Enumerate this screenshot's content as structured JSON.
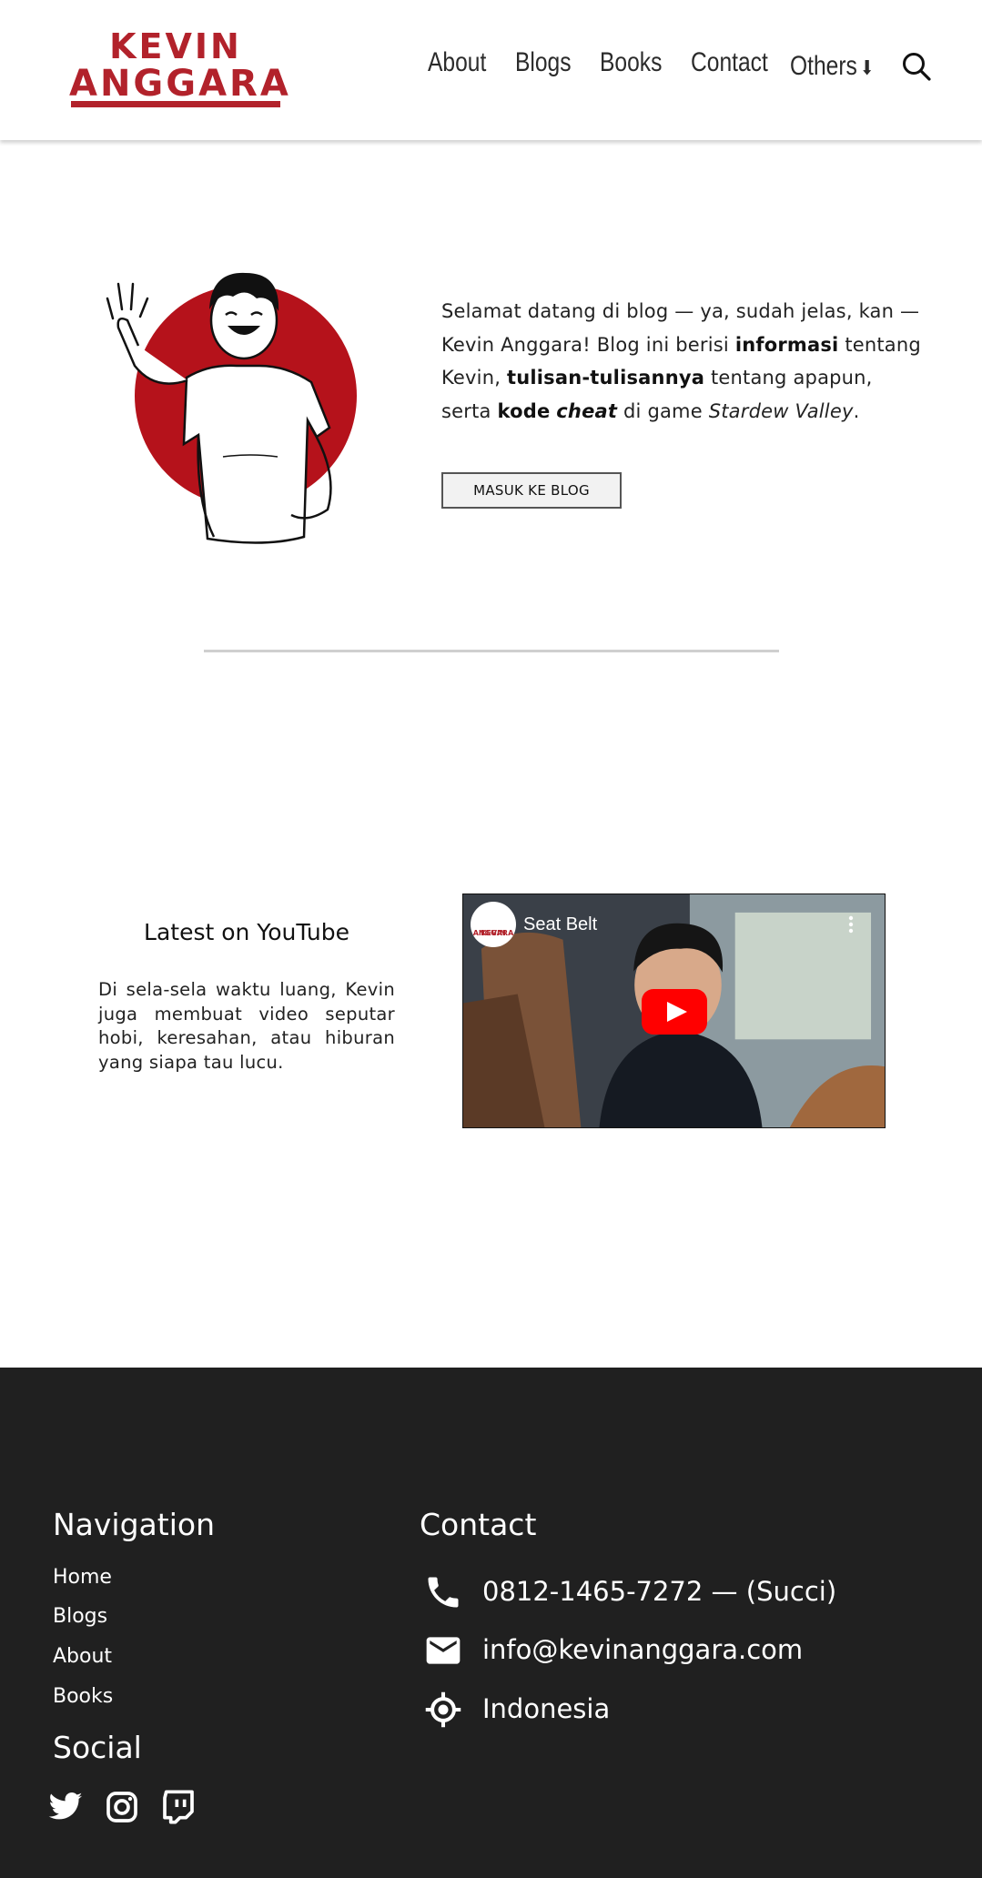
{
  "header": {
    "logo_line1": "KEVIN",
    "logo_line2": "ANGGARA",
    "nav": [
      "About",
      "Blogs",
      "Books",
      "Contact",
      "Others"
    ],
    "others_arrow": "⬇",
    "search_icon": "search-icon",
    "brand_color": "#b2222b"
  },
  "hero": {
    "illustration": "waving-man-illustration",
    "text_1": "Selamat datang di blog — ya, sudah jelas, kan — Kevin Anggara! Blog ini berisi ",
    "bold_1": "informasi",
    "text_2": " tentang Kevin, ",
    "bold_2": "tulisan-tulisannya",
    "text_3": " tentang apapun, serta ",
    "bold_3": "kode",
    "bold_italic": "cheat",
    "text_4": " di game ",
    "italic": "Stardew Valley",
    "text_5": ".",
    "button": "MASUK KE BLOG"
  },
  "youtube": {
    "title": "Latest on YouTube",
    "description": "Di sela-sela waktu luang, Kevin juga membuat video seputar hobi, keresahan, atau hiburan yang siapa tau lucu.",
    "video_title": "Seat Belt",
    "channel_avatar_text_1": "KEVIN",
    "channel_avatar_text_2": "ANGGARA"
  },
  "footer": {
    "navigation_heading": "Navigation",
    "nav_links": [
      "Home",
      "Blogs",
      "About",
      "Books"
    ],
    "social_heading": "Social",
    "social_icons": [
      "twitter-icon",
      "instagram-icon",
      "twitch-icon"
    ],
    "contact_heading": "Contact",
    "phone": "0812-1465-7272 — (Succi)",
    "email": "info@kevinanggara.com",
    "location": "Indonesia",
    "background_color": "#202020"
  }
}
